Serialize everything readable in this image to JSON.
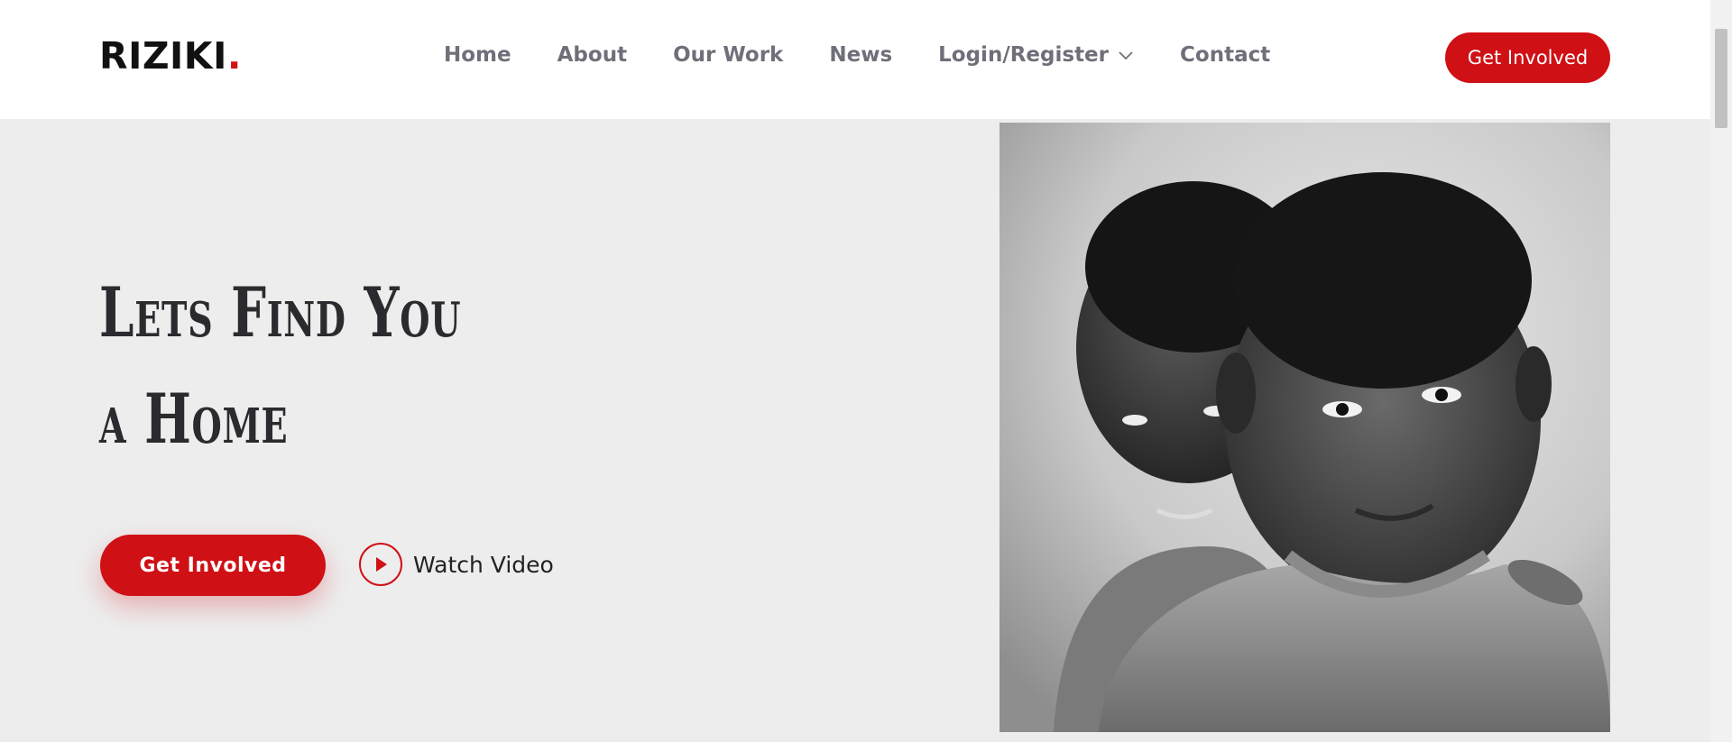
{
  "header": {
    "logo_text": "RIZIKI",
    "logo_dot": ".",
    "nav": [
      {
        "label": "Home"
      },
      {
        "label": "About"
      },
      {
        "label": "Our Work"
      },
      {
        "label": "News"
      },
      {
        "label": "Login/Register"
      },
      {
        "label": "Contact"
      }
    ],
    "cta_label": "Get Involved"
  },
  "hero": {
    "title_line1": "Lets Find You",
    "title_line2": "a Home",
    "cta_label": "Get Involved",
    "video_label": "Watch Video"
  },
  "colors": {
    "accent": "#cf1015",
    "background": "#ededed",
    "nav_text": "#6f6f7a"
  },
  "icons": [
    "chevron-down-icon",
    "play-icon"
  ]
}
